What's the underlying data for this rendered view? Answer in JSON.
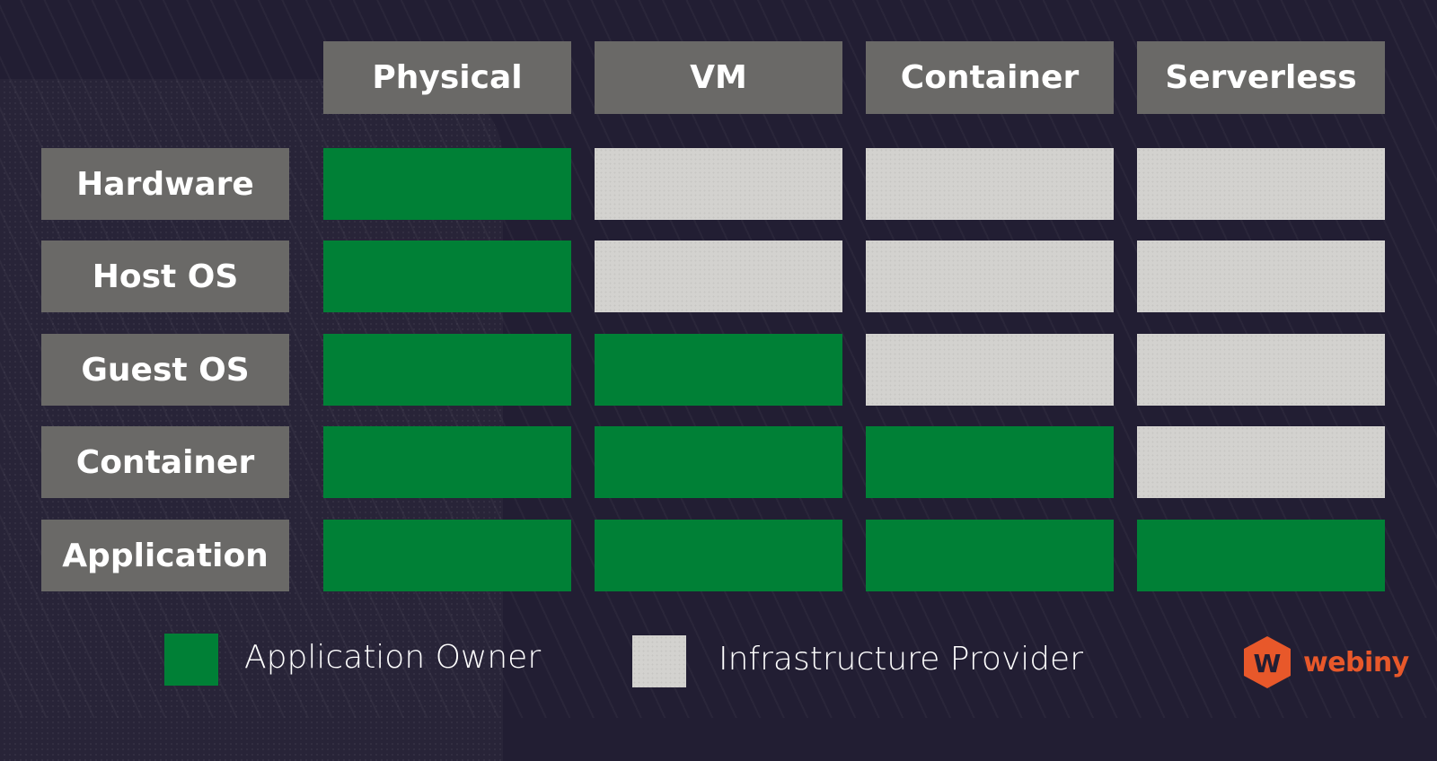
{
  "columns": [
    "Physical",
    "VM",
    "Container",
    "Serverless"
  ],
  "rows": [
    "Hardware",
    "Host OS",
    "Guest OS",
    "Container",
    "Application"
  ],
  "matrix": [
    [
      "owner",
      "provider",
      "provider",
      "provider"
    ],
    [
      "owner",
      "provider",
      "provider",
      "provider"
    ],
    [
      "owner",
      "owner",
      "provider",
      "provider"
    ],
    [
      "owner",
      "owner",
      "owner",
      "provider"
    ],
    [
      "owner",
      "owner",
      "owner",
      "owner"
    ]
  ],
  "legend": {
    "owner_label": "Application Owner",
    "provider_label": "Infrastructure Provider"
  },
  "colors": {
    "owner": "#008036",
    "provider": "#d3d2cf",
    "header": "#6a6967",
    "background": "#221e33",
    "brand": "#e8582a"
  },
  "brand": {
    "name": "webiny",
    "icon": "webiny-hexagon-w-icon",
    "icon_letter": "W"
  }
}
